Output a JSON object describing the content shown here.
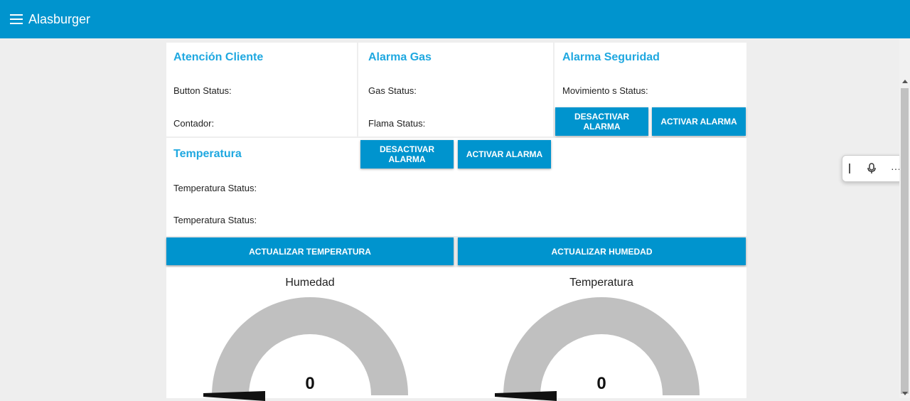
{
  "header": {
    "title": "Alasburger"
  },
  "atencion": {
    "title": "Atención Cliente",
    "button_status": "Button Status:",
    "contador": "Contador:"
  },
  "gas": {
    "title": "Alarma Gas",
    "gas_status": "Gas Status:",
    "flama_status": "Flama Status:",
    "deactivate": "DESACTIVAR ALARMA",
    "activate": "ACTIVAR ALARMA"
  },
  "seguridad": {
    "title": "Alarma Seguridad",
    "movimiento_status": "Movimiento s Status:",
    "deactivate": "DESACTIVAR ALARMA",
    "activate": "ACTIVAR ALARMA"
  },
  "temperatura": {
    "title": "Temperatura",
    "status_1": "Temperatura Status:",
    "status_2": "Temperatura Status:"
  },
  "actions": {
    "update_temp": "ACTUALIZAR TEMPERATURA",
    "update_hum": "ACTUALIZAR HUMEDAD"
  },
  "gauges": [
    {
      "title": "Humedad",
      "value": "0",
      "level": 0
    },
    {
      "title": "Temperatura",
      "value": "0",
      "level": 0
    }
  ],
  "colors": {
    "primary": "#0094ce",
    "title_accent": "#1fa8e0",
    "gauge_track": "#c0c0c0"
  }
}
